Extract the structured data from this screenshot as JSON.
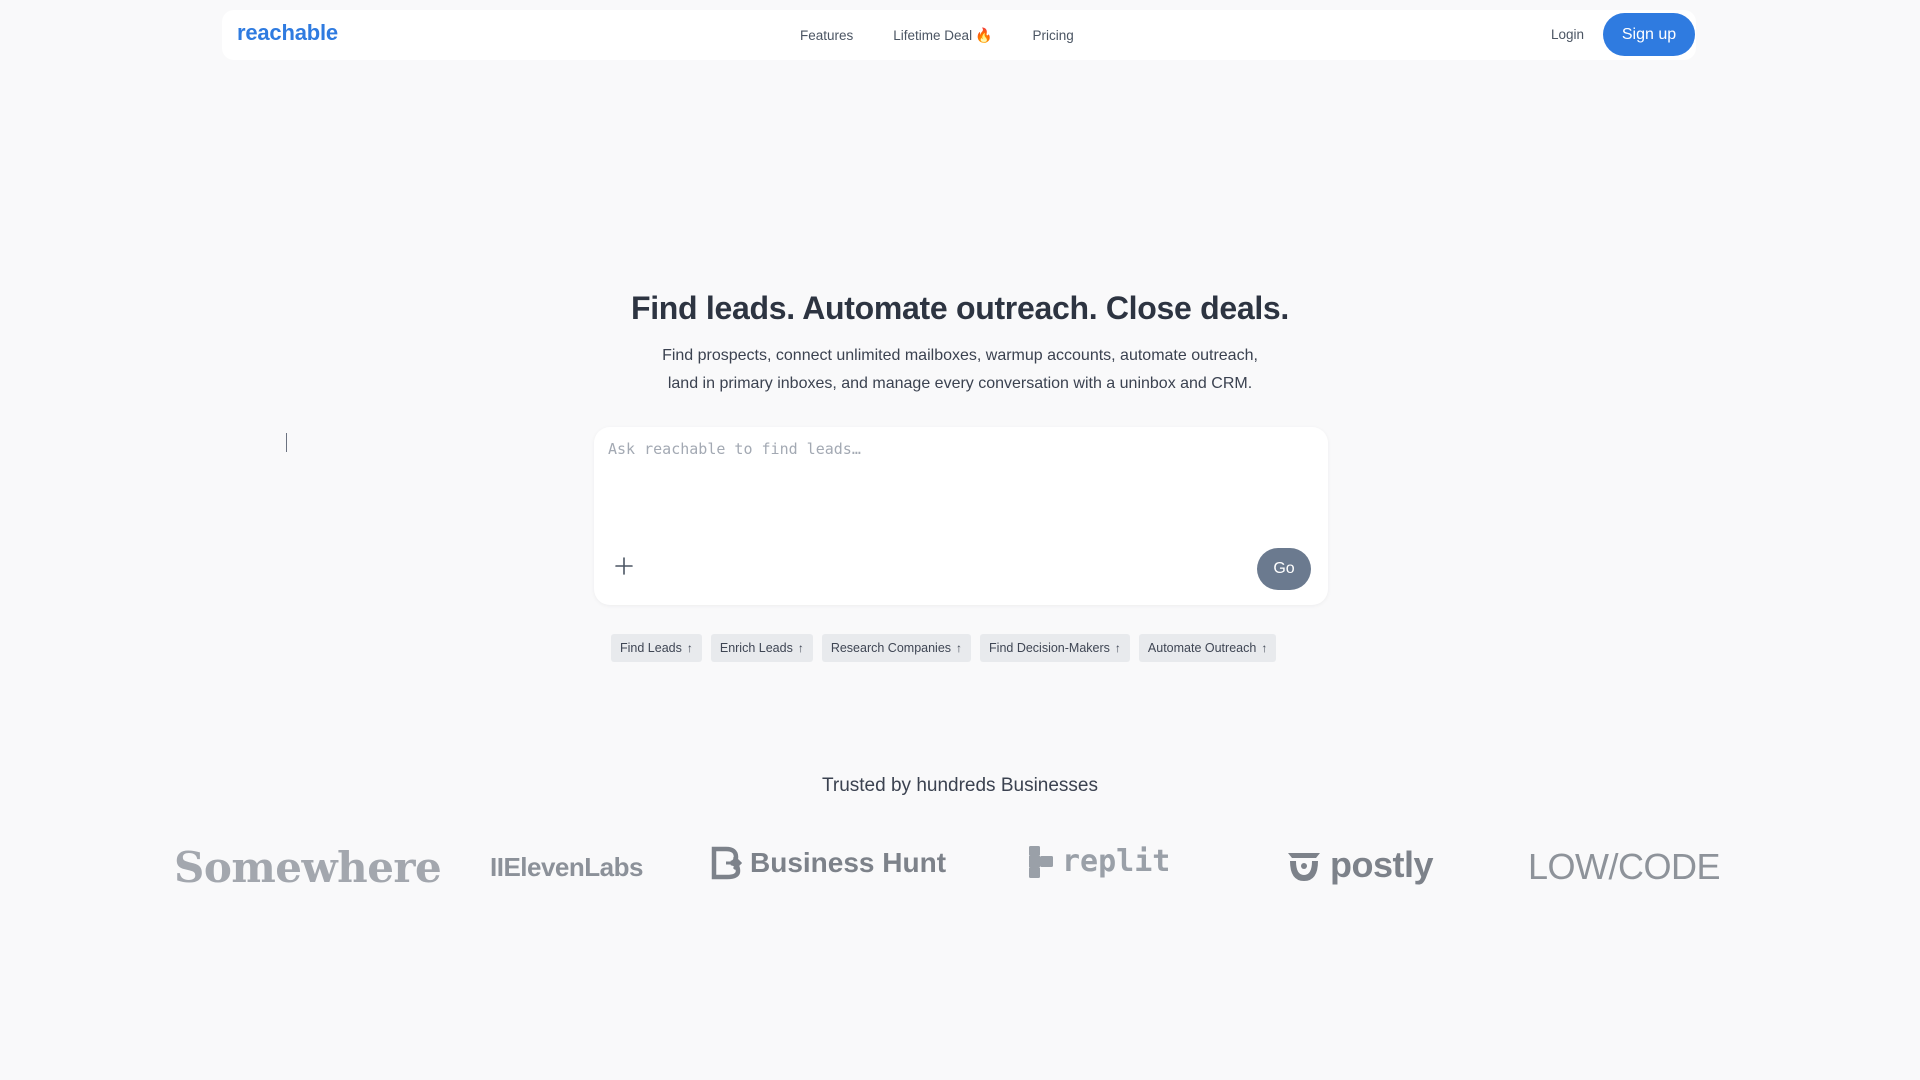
{
  "nav": {
    "logo": "reachable",
    "links": [
      "Features",
      "Lifetime Deal",
      "Pricing"
    ],
    "lifetime_deal_emoji": "🔥",
    "login": "Login",
    "signup": "Sign up"
  },
  "hero": {
    "title": "Find leads. Automate outreach. Close deals.",
    "subtitle_line1": "Find prospects, connect unlimited mailboxes, warmup accounts, automate outreach,",
    "subtitle_line2": "land in primary inboxes, and manage every conversation with a uninbox and CRM."
  },
  "prompt": {
    "placeholder": "Ask reachable to find leads…",
    "value": "",
    "add_icon": "plus-icon",
    "go_label": "Go"
  },
  "chips": [
    {
      "label": "Find Leads",
      "icon": "arrow-up-icon"
    },
    {
      "label": "Enrich Leads",
      "icon": "arrow-up-icon"
    },
    {
      "label": "Research Companies",
      "icon": "arrow-up-icon"
    },
    {
      "label": "Find Decision-Makers",
      "icon": "arrow-up-icon"
    },
    {
      "label": "Automate Outreach",
      "icon": "arrow-up-icon"
    }
  ],
  "trusted": {
    "heading": "Trusted by hundreds Businesses",
    "logos": [
      "Somewhere",
      "IIElevenLabs",
      "Business Hunt",
      "replit",
      "postly",
      "LOW/CODE"
    ]
  },
  "colors": {
    "brand": "#2f7be0",
    "background": "#f9f9fa",
    "go_button": "#6b7a8f",
    "chip_bg": "#e8eaed"
  }
}
